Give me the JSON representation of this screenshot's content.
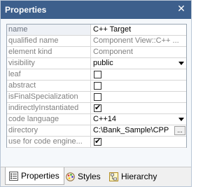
{
  "window": {
    "title": "Properties",
    "close_glyph": "✕"
  },
  "properties": [
    {
      "name": "name",
      "value": "C++ Target",
      "type": "text",
      "value_style": "dark"
    },
    {
      "name": "qualified name",
      "value": "Component View::C++ ...",
      "type": "text",
      "value_style": "dim"
    },
    {
      "name": "element kind",
      "value": "Component",
      "type": "text",
      "value_style": "dim"
    },
    {
      "name": "visibility",
      "value": "public",
      "type": "dropdown",
      "value_style": "dark"
    },
    {
      "name": "leaf",
      "checked": false,
      "type": "checkbox"
    },
    {
      "name": "abstract",
      "checked": false,
      "type": "checkbox"
    },
    {
      "name": "isFinalSpecialization",
      "checked": false,
      "type": "checkbox"
    },
    {
      "name": "indirectlyInstantiated",
      "checked": true,
      "type": "checkbox"
    },
    {
      "name": "code language",
      "value": "C++14",
      "type": "dropdown",
      "value_style": "dark"
    },
    {
      "name": "directory",
      "value": "C:\\Bank_Sample\\CPP",
      "type": "browse",
      "value_style": "dark",
      "button_label": "..."
    },
    {
      "name": "use for code engine...",
      "checked": true,
      "type": "checkbox"
    }
  ],
  "tabs": [
    {
      "label": "Properties",
      "icon": "properties-icon",
      "active": true
    },
    {
      "label": "Styles",
      "icon": "styles-icon",
      "active": false
    },
    {
      "label": "Hierarchy",
      "icon": "hierarchy-icon",
      "active": false
    }
  ],
  "colors": {
    "titlebar": "#3d5f8c",
    "accent": "#3d5f8c"
  }
}
